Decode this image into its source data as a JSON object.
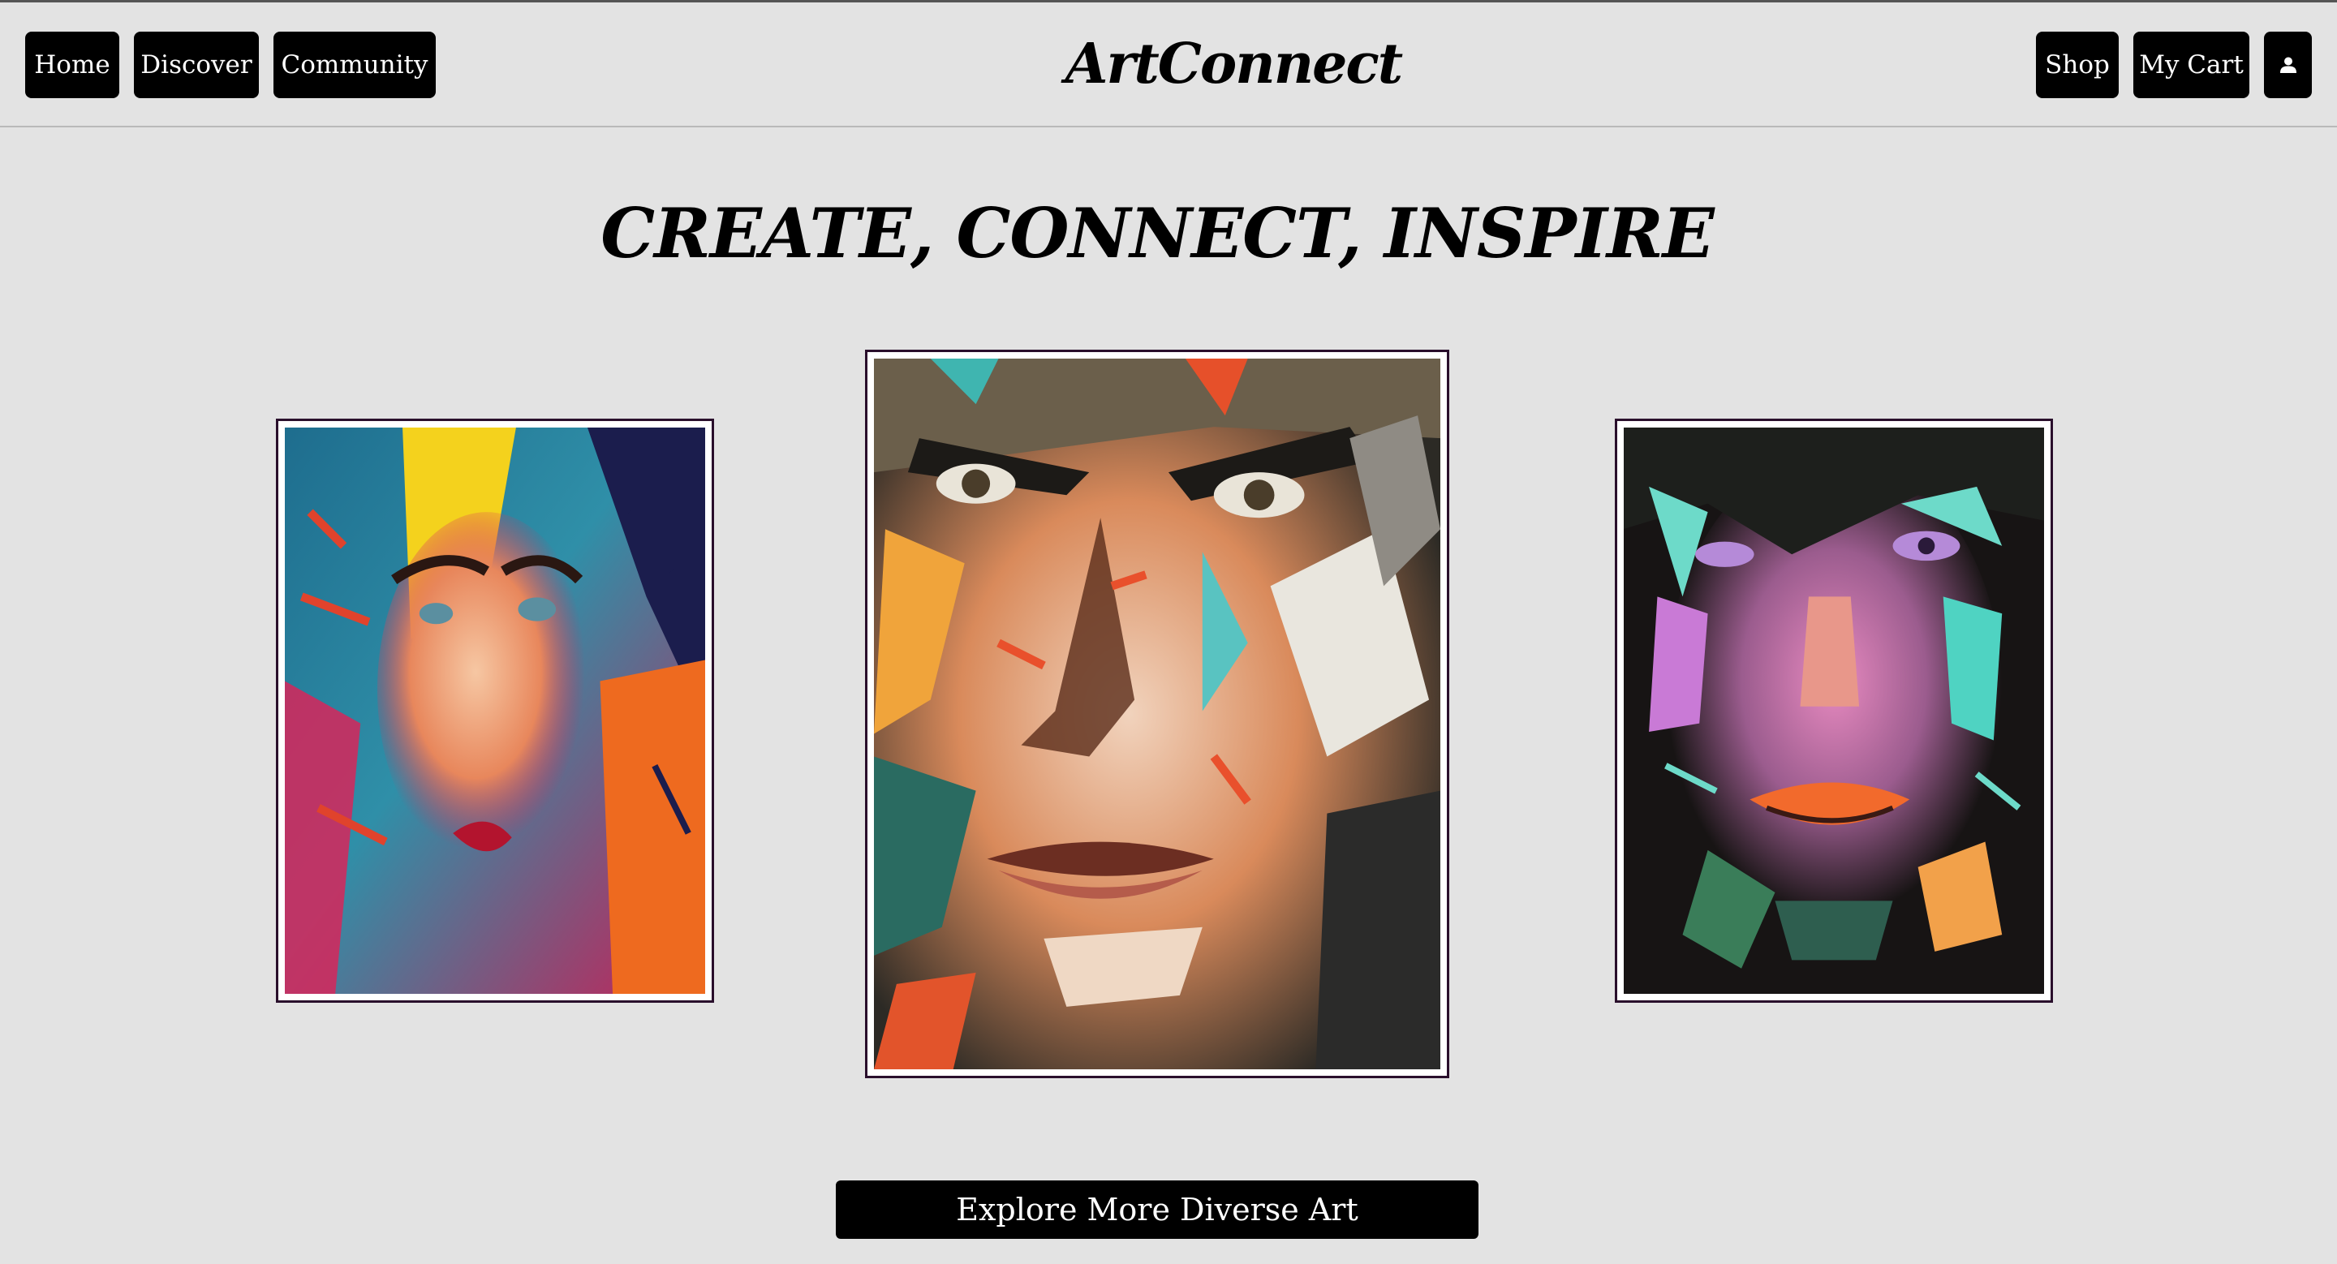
{
  "nav": {
    "home": "Home",
    "discover": "Discover",
    "community": "Community",
    "shop": "Shop",
    "my_cart": "My Cart",
    "profile_icon": "user-icon"
  },
  "brand": {
    "title": "ArtConnect"
  },
  "hero": {
    "title": "CREATE, CONNECT, INSPIRE"
  },
  "gallery": {
    "artworks": [
      {
        "subject": "colorful-portrait-woman",
        "accent": "#d7265a"
      },
      {
        "subject": "palette-knife-portrait-man",
        "accent": "#e5552a"
      },
      {
        "subject": "dark-palette-knife-portrait",
        "accent": "#b58ad8"
      }
    ]
  },
  "cta": {
    "label": "Explore More Diverse Art"
  },
  "colors": {
    "background": "#e3e3e3",
    "button": "#000000",
    "frame_border": "#2a0f2c"
  }
}
